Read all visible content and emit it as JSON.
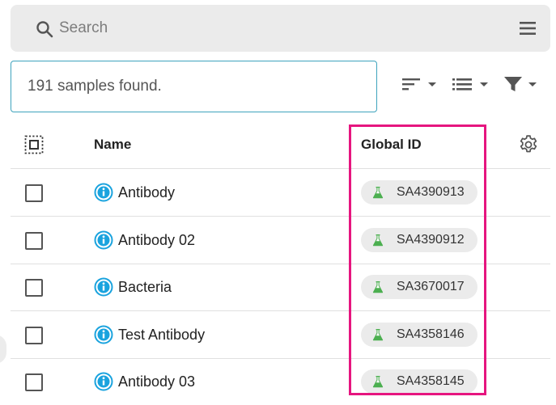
{
  "search": {
    "placeholder": "Search"
  },
  "status": {
    "text": "191 samples found."
  },
  "table": {
    "headers": {
      "name": "Name",
      "global_id": "Global ID"
    },
    "rows": [
      {
        "name": "Antibody",
        "global_id": "SA4390913"
      },
      {
        "name": "Antibody 02",
        "global_id": "SA4390912"
      },
      {
        "name": "Bacteria",
        "global_id": "SA3670017"
      },
      {
        "name": "Test Antibody",
        "global_id": "SA4358146"
      },
      {
        "name": "Antibody 03",
        "global_id": "SA4358145"
      }
    ]
  },
  "icons": {
    "search": "search-icon",
    "menu": "hamburger-menu-icon",
    "sort": "sort-icon",
    "view": "list-view-icon",
    "filter": "filter-icon",
    "select_all": "select-all-icon",
    "settings": "gear-icon",
    "info": "info-icon",
    "sample": "flask-icon"
  },
  "colors": {
    "accent": "#e6157f",
    "info": "#1aa3de",
    "flask": "#4caf50",
    "status_border": "#3ea3bd"
  }
}
